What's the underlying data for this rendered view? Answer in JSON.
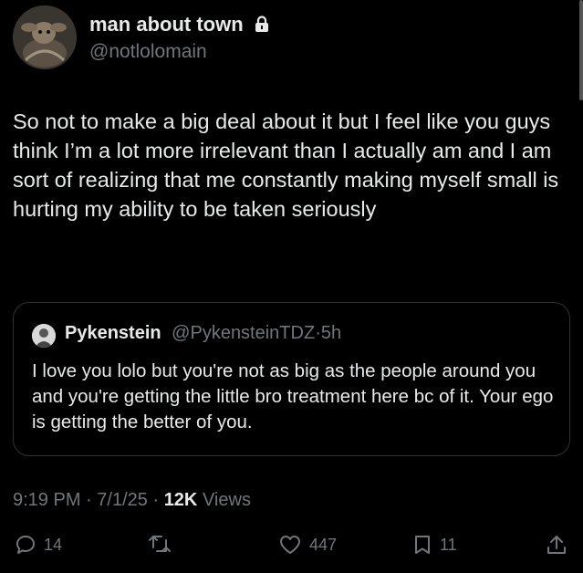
{
  "author": {
    "display_name": "man about town",
    "handle": "@notlolomain",
    "protected_icon": "lock-icon",
    "avatar_icon": "avatar-image"
  },
  "tweet": {
    "text": "So not to make a big deal about it but I feel like you guys think I’m a lot more irrelevant than I actually am and I am sort of realizing that me constantly making myself small is hurting my ability to be taken seriously"
  },
  "quote": {
    "name": "Pykenstein",
    "handle": "@PykensteinTDZ",
    "separator": "·",
    "time": "5h",
    "text": "I love you lolo but you're not as big as the people around you and you're getting the little bro treatment here bc of it. Your ego is getting the better of you."
  },
  "meta": {
    "time": "9:19 PM",
    "separator": "·",
    "date": "7/1/25",
    "views_count": "12K",
    "views_label": "Views"
  },
  "actions": {
    "replies": "14",
    "retweets": "",
    "likes": "447",
    "bookmarks": "11"
  },
  "colors": {
    "background": "#000000",
    "text": "#e7e9ea",
    "secondary": "#71767b",
    "border": "#2f3336"
  }
}
